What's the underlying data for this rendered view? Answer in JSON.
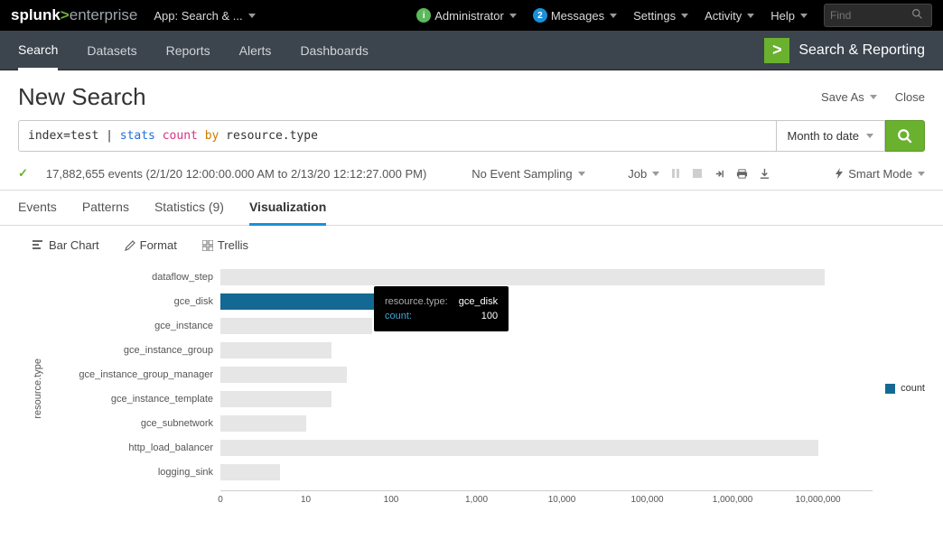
{
  "top": {
    "app_label": "App: Search & ...",
    "admin": "Administrator",
    "messages": "Messages",
    "messages_count": "2",
    "admin_badge": "i",
    "settings": "Settings",
    "activity": "Activity",
    "help": "Help",
    "find_placeholder": "Find"
  },
  "nav": {
    "search": "Search",
    "datasets": "Datasets",
    "reports": "Reports",
    "alerts": "Alerts",
    "dashboards": "Dashboards",
    "app_name": "Search & Reporting"
  },
  "title": {
    "heading": "New Search",
    "save_as": "Save As",
    "close": "Close"
  },
  "search": {
    "prefix": "index=test | ",
    "stats": "stats",
    "count": "count",
    "by": "by",
    "suffix": " resource.type",
    "time_range": "Month to date"
  },
  "status": {
    "event_count": "17,882,655 events (2/1/20 12:00:00.000 AM to 2/13/20 12:12:27.000 PM)",
    "sampling": "No Event Sampling",
    "job": "Job",
    "smart": "Smart Mode"
  },
  "tabs": {
    "events": "Events",
    "patterns": "Patterns",
    "statistics": "Statistics (9)",
    "visualization": "Visualization"
  },
  "viztool": {
    "chart_type": "Bar Chart",
    "format": "Format",
    "trellis": "Trellis"
  },
  "legend": {
    "label": "count"
  },
  "tooltip": {
    "key1": "resource.type:",
    "val1": "gce_disk",
    "key2": "count:",
    "val2": "100"
  },
  "chart_data": {
    "type": "bar",
    "orientation": "horizontal",
    "ylabel": "resource.type",
    "x_scale": "log",
    "x_ticks": [
      "0",
      "10",
      "100",
      "1,000",
      "10,000",
      "100,000",
      "1,000,000",
      "10,000,000"
    ],
    "categories": [
      "dataflow_step",
      "gce_disk",
      "gce_instance",
      "gce_instance_group",
      "gce_instance_group_manager",
      "gce_instance_template",
      "gce_subnetwork",
      "http_load_balancer",
      "logging_sink"
    ],
    "series": [
      {
        "name": "count",
        "values": [
          12000000,
          100,
          60,
          20,
          30,
          20,
          10,
          10000000,
          5
        ]
      }
    ],
    "highlighted_index": 1
  }
}
